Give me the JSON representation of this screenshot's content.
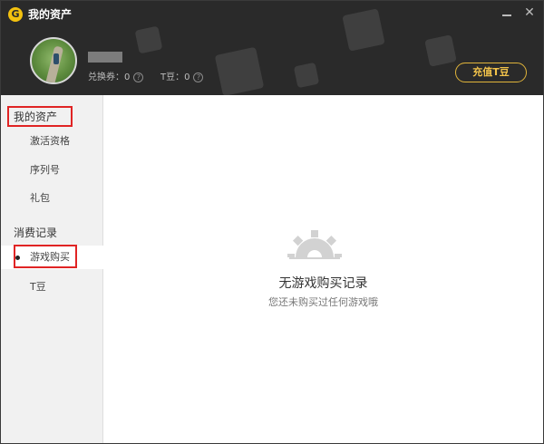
{
  "window": {
    "title": "我的资产"
  },
  "header": {
    "logo_glyph": "G",
    "close_glyph": "✕",
    "coupon_label": "兑换券：0",
    "tbean_label": "T豆：0",
    "help_glyph": "?",
    "recharge_label": "充值T豆",
    "accent_color": "#f1c24a"
  },
  "sidebar": {
    "section_assets": "我的资产",
    "items_assets": [
      {
        "label": "激活资格"
      },
      {
        "label": "序列号"
      },
      {
        "label": "礼包"
      }
    ],
    "section_records": "消费记录",
    "items_records": [
      {
        "label": "游戏购买",
        "selected": true
      },
      {
        "label": "T豆"
      }
    ]
  },
  "main": {
    "empty_icon": "gear-icon",
    "empty_title": "无游戏购买记录",
    "empty_subtitle": "您还未购买过任何游戏哦"
  },
  "annotation_color": "#e02424"
}
